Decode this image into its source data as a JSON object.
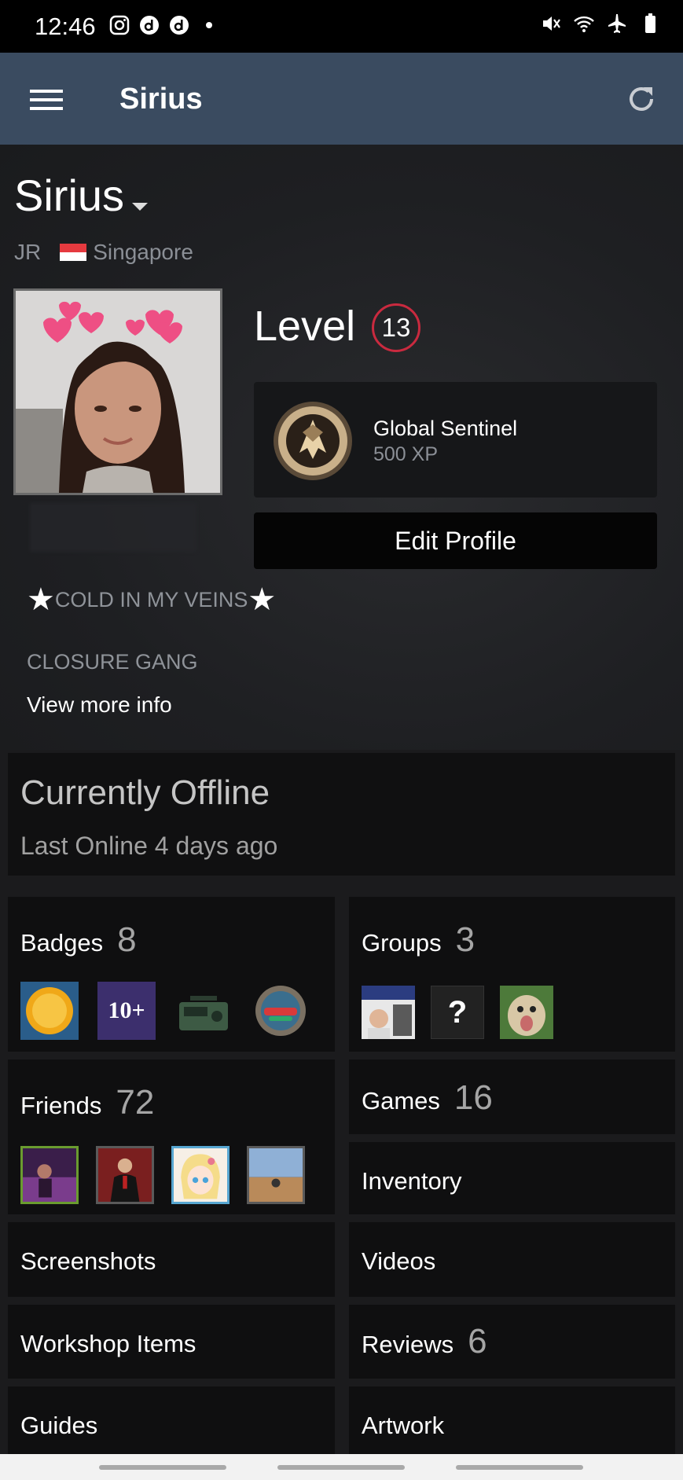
{
  "status_bar": {
    "time": "12:46"
  },
  "app_bar": {
    "title": "Sirius"
  },
  "profile": {
    "name": "Sirius",
    "real_name": "JR",
    "country": "Singapore",
    "level_label": "Level",
    "level": "13",
    "featured_badge": {
      "name": "Global Sentinel",
      "xp": "500 XP"
    },
    "edit_profile_label": "Edit Profile",
    "tagline": "COLD IN MY VEINS",
    "summary_line": "CLOSURE GANG",
    "view_more_label": "View more info"
  },
  "status": {
    "title": "Currently Offline",
    "subtitle": "Last Online 4 days ago"
  },
  "tiles": {
    "badges": {
      "label": "Badges",
      "count": "8",
      "thumb_text": "10+"
    },
    "groups": {
      "label": "Groups",
      "count": "3",
      "thumb_text": "?"
    },
    "friends": {
      "label": "Friends",
      "count": "72"
    },
    "games": {
      "label": "Games",
      "count": "16"
    },
    "inventory": {
      "label": "Inventory"
    },
    "screenshots": {
      "label": "Screenshots"
    },
    "videos": {
      "label": "Videos"
    },
    "workshop": {
      "label": "Workshop Items"
    },
    "reviews": {
      "label": "Reviews",
      "count": "6"
    },
    "guides": {
      "label": "Guides"
    },
    "artwork": {
      "label": "Artwork"
    }
  },
  "colors": {
    "app_bar": "#3a4b60",
    "level_ring": "#c92a3f",
    "background": "#1b1b1d",
    "tile": "#0f0f10"
  }
}
